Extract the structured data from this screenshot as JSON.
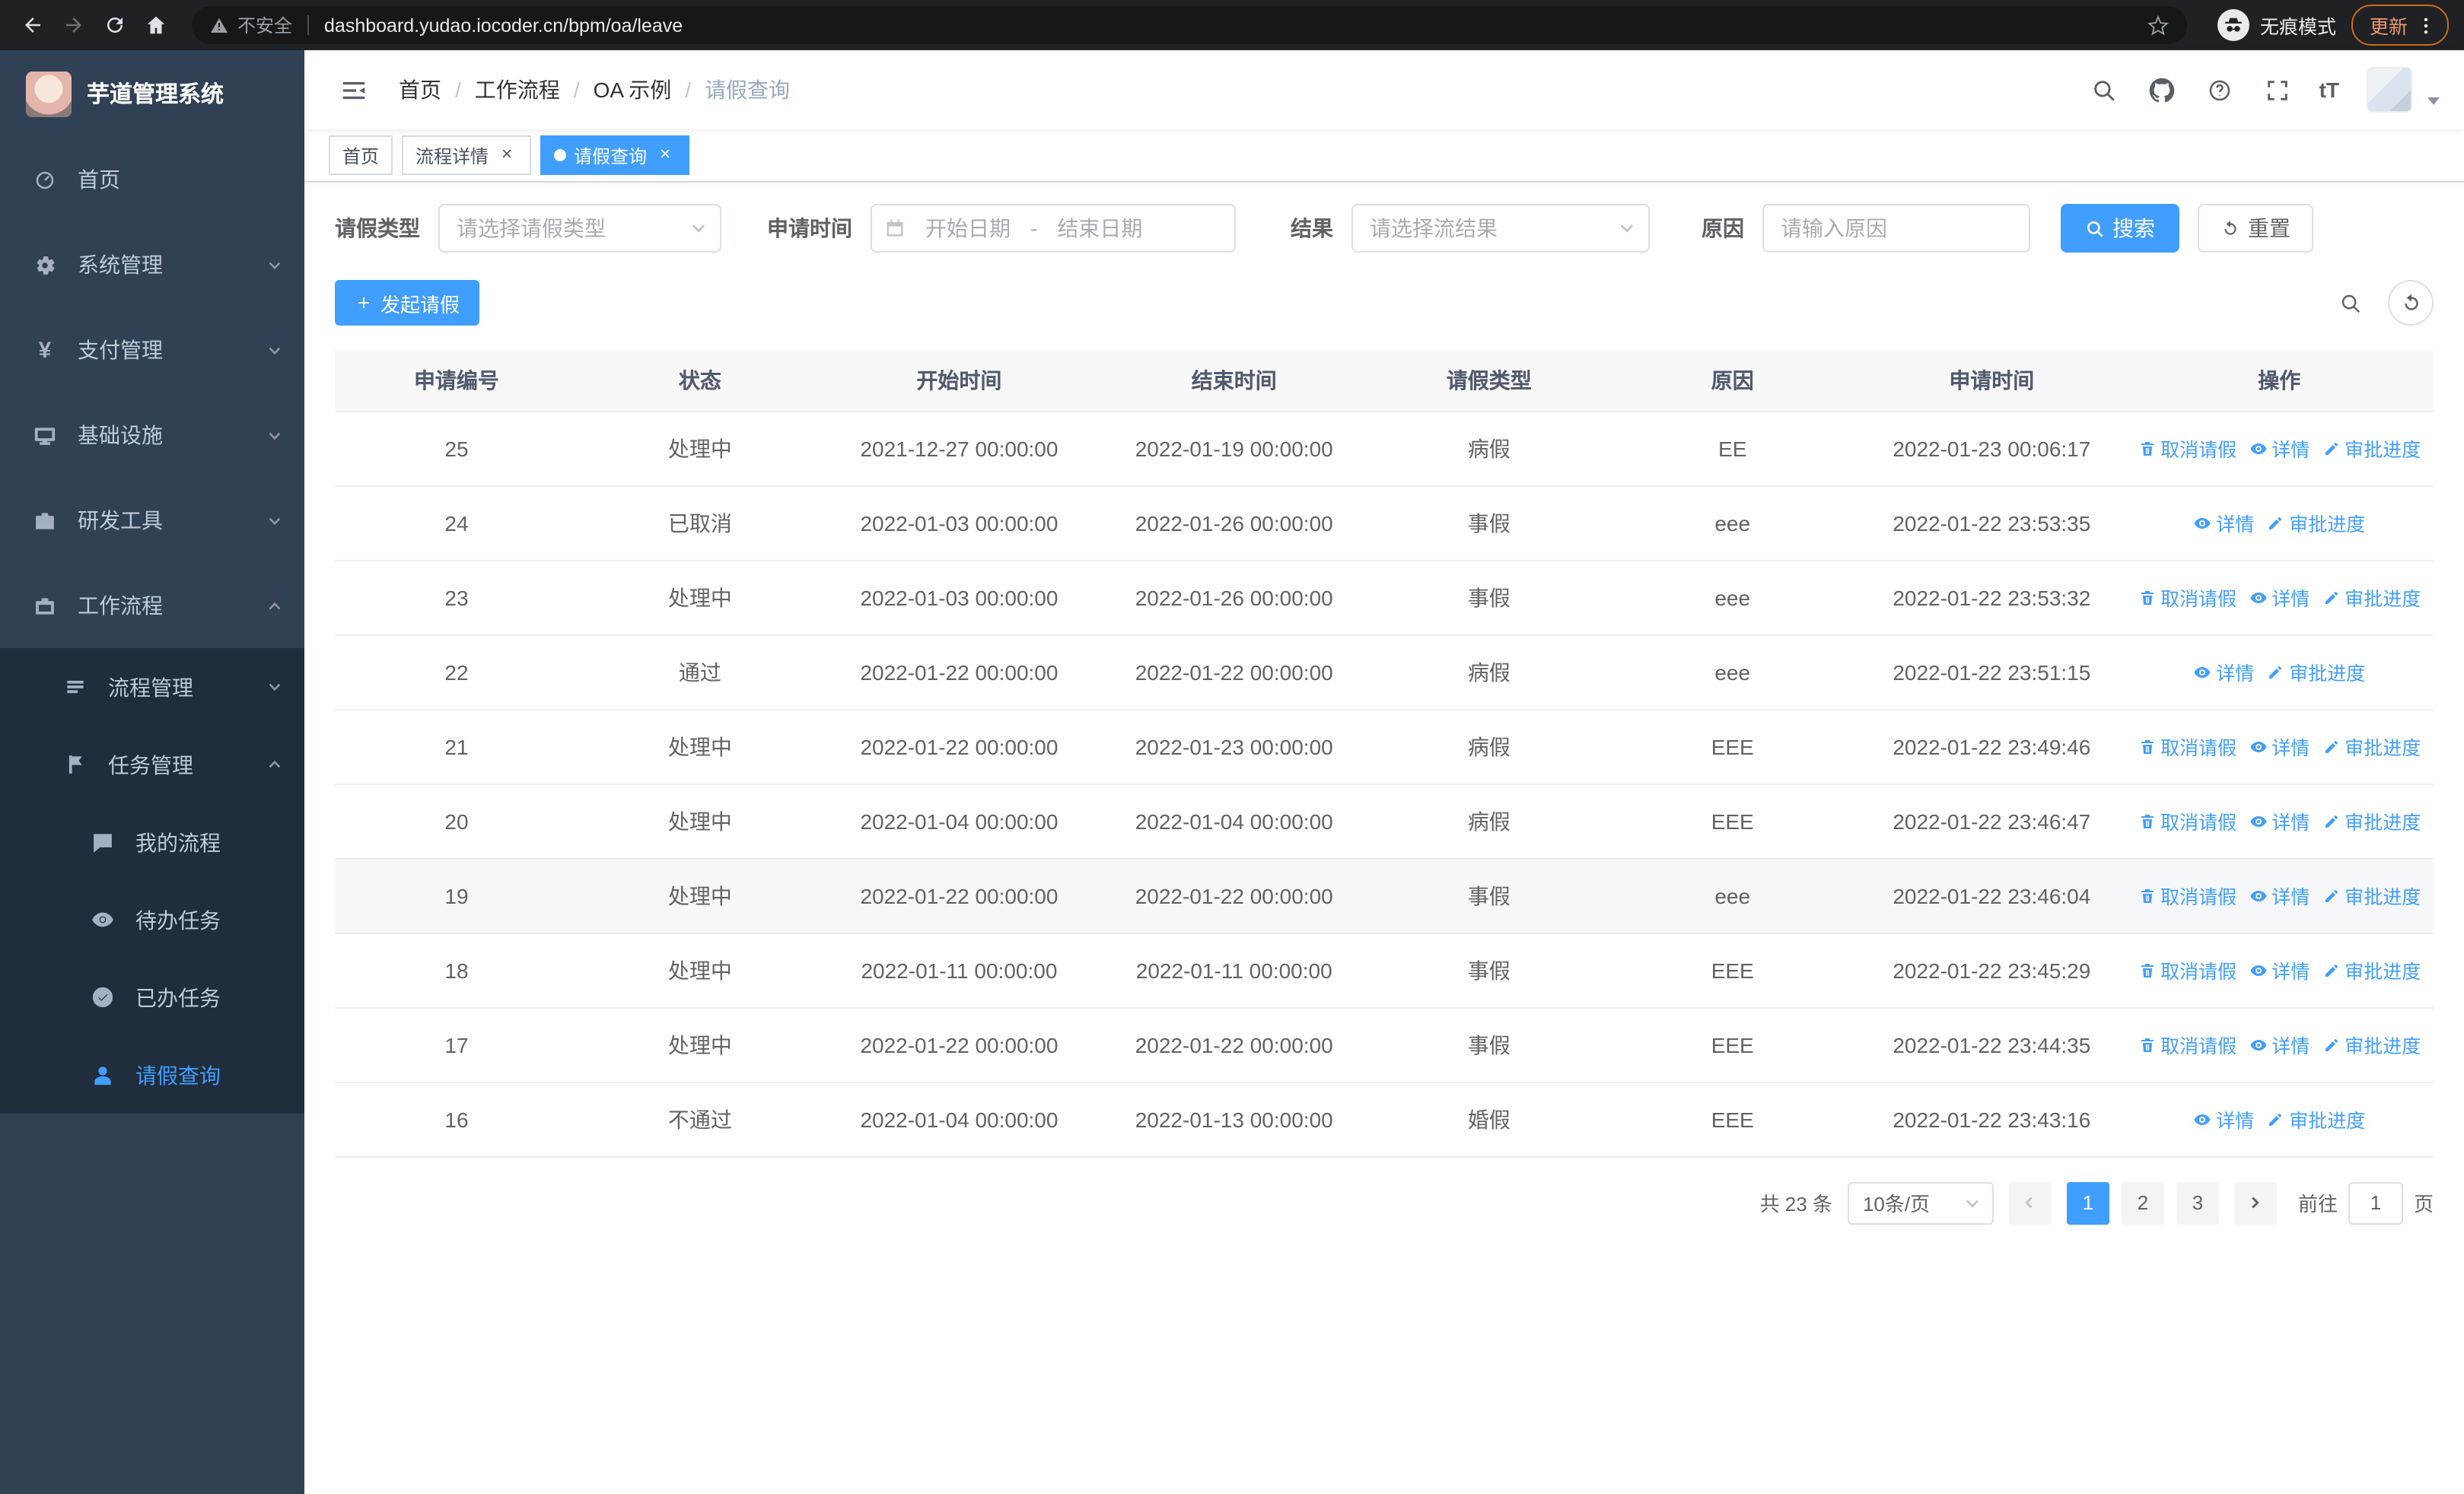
{
  "browser": {
    "security_label": "不安全",
    "url": "dashboard.yudao.iocoder.cn/bpm/oa/leave",
    "incognito_label": "无痕模式",
    "update_label": "更新"
  },
  "navbar": {
    "breadcrumb": [
      "首页",
      "工作流程",
      "OA 示例",
      "请假查询"
    ],
    "font_size_text": "tT"
  },
  "sidebar": {
    "logo_title": "芋道管理系统",
    "items": [
      {
        "key": "home",
        "label": "首页",
        "icon": "dashboard-icon"
      },
      {
        "key": "system",
        "label": "系统管理",
        "icon": "gear-icon",
        "chevron": "down"
      },
      {
        "key": "payment",
        "label": "支付管理",
        "icon": "yen-icon",
        "chevron": "down"
      },
      {
        "key": "infrastructure",
        "label": "基础设施",
        "icon": "monitor-icon",
        "chevron": "down"
      },
      {
        "key": "devtools",
        "label": "研发工具",
        "icon": "toolbox-icon",
        "chevron": "down"
      },
      {
        "key": "workflow",
        "label": "工作流程",
        "icon": "suitcase-icon",
        "chevron": "up",
        "expanded": true
      }
    ],
    "workflow_children": [
      {
        "key": "process-mgmt",
        "label": "流程管理",
        "icon": "list-icon",
        "chevron": "down",
        "level": 2
      },
      {
        "key": "task-mgmt",
        "label": "任务管理",
        "icon": "flag-icon",
        "chevron": "up",
        "level": 2
      },
      {
        "key": "my-processes",
        "label": "我的流程",
        "icon": "chat-icon",
        "level": 3
      },
      {
        "key": "todo-tasks",
        "label": "待办任务",
        "icon": "eye-icon",
        "level": 3
      },
      {
        "key": "done-tasks",
        "label": "已办任务",
        "icon": "check-circle-icon",
        "level": 3
      },
      {
        "key": "leave-query",
        "label": "请假查询",
        "icon": "user-icon",
        "level": 3,
        "active": true
      }
    ]
  },
  "tags": [
    {
      "key": "home",
      "label": "首页",
      "closable": false,
      "active": false
    },
    {
      "key": "process-detail",
      "label": "流程详情",
      "closable": true,
      "active": false
    },
    {
      "key": "leave-query",
      "label": "请假查询",
      "closable": true,
      "active": true
    }
  ],
  "filters": {
    "leave_type_label": "请假类型",
    "leave_type_placeholder": "请选择请假类型",
    "apply_time_label": "申请时间",
    "start_date_placeholder": "开始日期",
    "range_separator": "-",
    "end_date_placeholder": "结束日期",
    "result_label": "结果",
    "result_placeholder": "请选择流结果",
    "reason_label": "原因",
    "reason_placeholder": "请输入原因",
    "search_button": "搜索",
    "reset_button": "重置"
  },
  "toolbar": {
    "create_button": "发起请假"
  },
  "table": {
    "columns": [
      "申请编号",
      "状态",
      "开始时间",
      "结束时间",
      "请假类型",
      "原因",
      "申请时间",
      "操作"
    ],
    "action_labels": {
      "cancel": "取消请假",
      "detail": "详情",
      "progress": "审批进度"
    },
    "rows": [
      {
        "id": "25",
        "status": "处理中",
        "start": "2021-12-27 00:00:00",
        "end": "2022-01-19 00:00:00",
        "type": "病假",
        "reason": "EE",
        "applied": "2022-01-23 00:06:17",
        "actions": [
          "cancel",
          "detail",
          "progress"
        ]
      },
      {
        "id": "24",
        "status": "已取消",
        "start": "2022-01-03 00:00:00",
        "end": "2022-01-26 00:00:00",
        "type": "事假",
        "reason": "eee",
        "applied": "2022-01-22 23:53:35",
        "actions": [
          "detail",
          "progress"
        ]
      },
      {
        "id": "23",
        "status": "处理中",
        "start": "2022-01-03 00:00:00",
        "end": "2022-01-26 00:00:00",
        "type": "事假",
        "reason": "eee",
        "applied": "2022-01-22 23:53:32",
        "actions": [
          "cancel",
          "detail",
          "progress"
        ]
      },
      {
        "id": "22",
        "status": "通过",
        "start": "2022-01-22 00:00:00",
        "end": "2022-01-22 00:00:00",
        "type": "病假",
        "reason": "eee",
        "applied": "2022-01-22 23:51:15",
        "actions": [
          "detail",
          "progress"
        ]
      },
      {
        "id": "21",
        "status": "处理中",
        "start": "2022-01-22 00:00:00",
        "end": "2022-01-23 00:00:00",
        "type": "病假",
        "reason": "EEE",
        "applied": "2022-01-22 23:49:46",
        "actions": [
          "cancel",
          "detail",
          "progress"
        ]
      },
      {
        "id": "20",
        "status": "处理中",
        "start": "2022-01-04 00:00:00",
        "end": "2022-01-04 00:00:00",
        "type": "病假",
        "reason": "EEE",
        "applied": "2022-01-22 23:46:47",
        "actions": [
          "cancel",
          "detail",
          "progress"
        ]
      },
      {
        "id": "19",
        "status": "处理中",
        "start": "2022-01-22 00:00:00",
        "end": "2022-01-22 00:00:00",
        "type": "事假",
        "reason": "eee",
        "applied": "2022-01-22 23:46:04",
        "actions": [
          "cancel",
          "detail",
          "progress"
        ],
        "highlight": true
      },
      {
        "id": "18",
        "status": "处理中",
        "start": "2022-01-11 00:00:00",
        "end": "2022-01-11 00:00:00",
        "type": "事假",
        "reason": "EEE",
        "applied": "2022-01-22 23:45:29",
        "actions": [
          "cancel",
          "detail",
          "progress"
        ]
      },
      {
        "id": "17",
        "status": "处理中",
        "start": "2022-01-22 00:00:00",
        "end": "2022-01-22 00:00:00",
        "type": "事假",
        "reason": "EEE",
        "applied": "2022-01-22 23:44:35",
        "actions": [
          "cancel",
          "detail",
          "progress"
        ]
      },
      {
        "id": "16",
        "status": "不通过",
        "start": "2022-01-04 00:00:00",
        "end": "2022-01-13 00:00:00",
        "type": "婚假",
        "reason": "EEE",
        "applied": "2022-01-22 23:43:16",
        "actions": [
          "detail",
          "progress"
        ]
      }
    ]
  },
  "pagination": {
    "total_text": "共 23 条",
    "page_size_value": "10条/页",
    "pages": [
      "1",
      "2",
      "3"
    ],
    "active_page": "1",
    "goto_label": "前往",
    "goto_value": "1",
    "goto_unit": "页"
  },
  "colors": {
    "primary": "#409eff",
    "sidebar_bg": "#304156",
    "submenu_bg": "#1f2d3d"
  }
}
